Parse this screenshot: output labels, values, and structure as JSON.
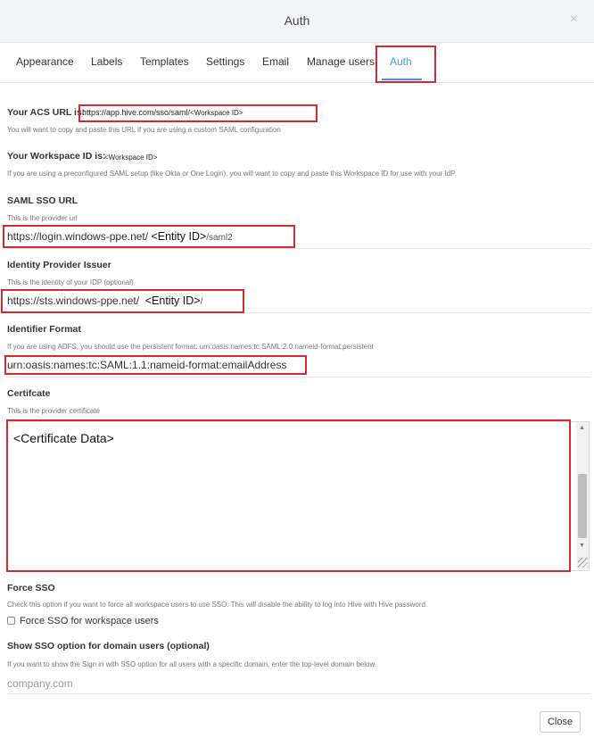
{
  "modal": {
    "title": "Auth",
    "close_glyph": "×",
    "close_label": "Close"
  },
  "tabs": [
    "Appearance",
    "Labels",
    "Templates",
    "Settings",
    "Email",
    "Manage users",
    "Auth"
  ],
  "active_tab": "Auth",
  "acs": {
    "label": "Your ACS URL is:",
    "url": "https://app.hive.com/sso/saml/",
    "workspace": "<Workspace ID>",
    "help": "You will want to copy and paste this URL if you are using a custom SAML configuration"
  },
  "workspace_id": {
    "label": "Your Workspace ID is:",
    "value": "<Workspace ID>",
    "help": "If you are using a preconfigured SAML setup (like Okta or One Login), you will want to copy and paste this Workspace ID for use with your IdP"
  },
  "saml_sso_url": {
    "label": "SAML SSO URL",
    "help": "This is the provider url",
    "prefix": "https://login.windows-ppe.net/",
    "entity": "<Entity ID>",
    "suffix": "/saml2"
  },
  "idp_issuer": {
    "label": "Identity Provider Issuer",
    "help": "This is the identity of your IDP (optional)",
    "prefix": "https://sts.windows-ppe.net/",
    "entity": "<Entity ID>",
    "suffix": "/"
  },
  "identifier_format": {
    "label": "Identifier Format",
    "help": "If you are using ADFS, you should use the persistent format: urn:oasis:names:tc:SAML:2.0:nameid-format:persistent",
    "value": "urn:oasis:names:tc:SAML:1.1:nameid-format:emailAddress"
  },
  "certificate": {
    "label": "Certifcate",
    "help": "This is the provider certificate",
    "value": "<Certificate Data>"
  },
  "force_sso": {
    "label": "Force SSO",
    "help": "Check this option if you want to force all workspace users to use SSO. This will disable the ability to log into Hive with Hive password.",
    "checkbox_label": "Force SSO for workspace users",
    "checked": false
  },
  "domain_sso": {
    "label": "Show SSO option for domain users (optional)",
    "help": "If you want to show the Sign in with SSO option for all users with a specific domain, enter the top-level domain below.",
    "placeholder": "company.com"
  },
  "colors": {
    "accent": "#4a90e2",
    "highlight_border": "#d7282f",
    "header_bg": "#f4f5f7"
  },
  "icons": {
    "close": "close-icon",
    "checkbox": "checkbox-icon",
    "resize": "resize-grip-icon"
  }
}
